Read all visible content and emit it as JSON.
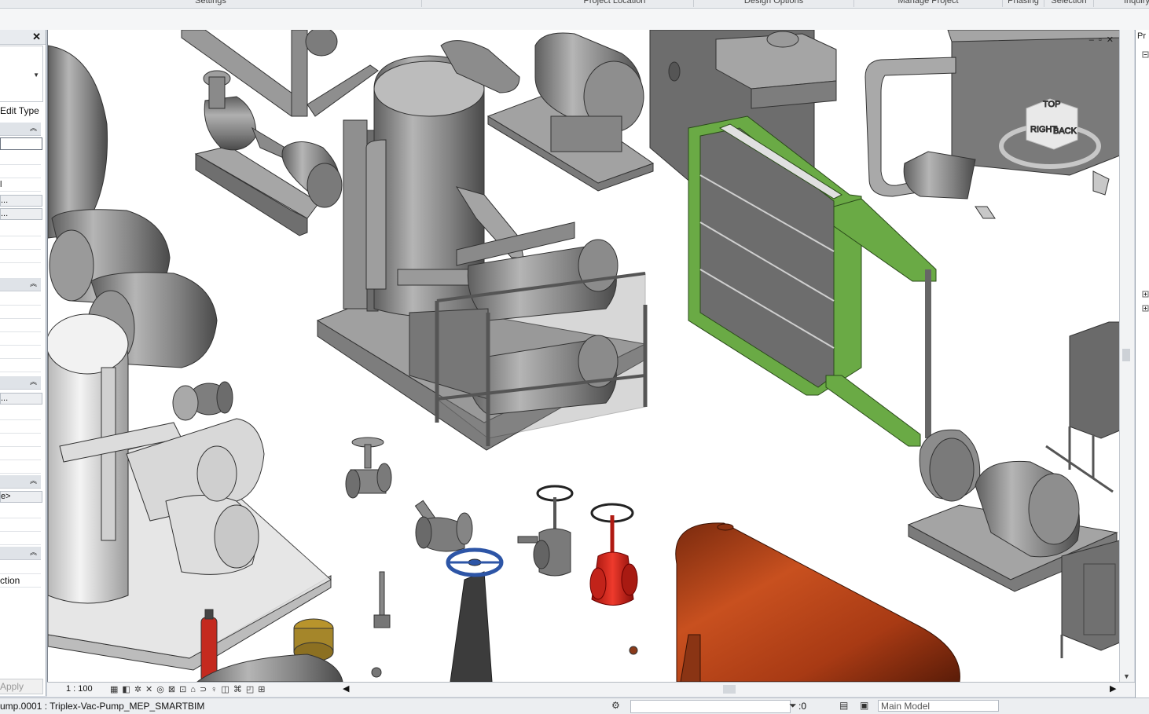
{
  "ribbon": {
    "groups": [
      "Settings",
      "Project Location",
      "Design Options",
      "Manage Project",
      "Phasing",
      "Selection",
      "Inquiry"
    ]
  },
  "properties": {
    "edit_type_label": "Edit Type",
    "rows": [
      "l",
      "...",
      "..."
    ],
    "button_more": "...",
    "button_browse": "e>",
    "last_row": "ction",
    "apply_label": "Apply"
  },
  "navcube": {
    "face_top": "TOP",
    "face_right": "RIGHT",
    "face_back": "BACK"
  },
  "view_control_bar": {
    "scale": "1 : 100"
  },
  "right_panel": {
    "tab_label": "Pr"
  },
  "status_bar": {
    "selection_text": "ump.0001 : Triplex-Vac-Pump_MEP_SMARTBIM",
    "selection_count": ":0",
    "active_model": "Main Model"
  },
  "colors": {
    "highlight_green": "#6aaa45",
    "equipment_gray": "#8a8a8a",
    "tank_orange": "#b8461c",
    "valve_red": "#d9251c",
    "handwheel_blue": "#2d55a6"
  }
}
